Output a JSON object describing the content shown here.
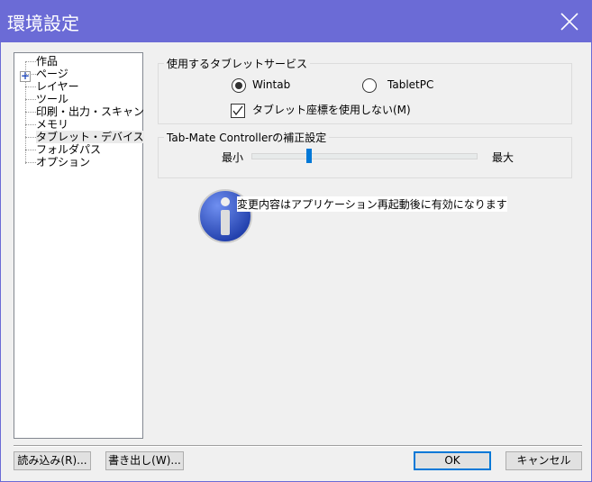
{
  "window": {
    "title": "環境設定"
  },
  "tree": {
    "items": [
      {
        "label": "作品"
      },
      {
        "label": "ページ",
        "expandable": true
      },
      {
        "label": "レイヤー"
      },
      {
        "label": "ツール"
      },
      {
        "label": "印刷・出力・スキャン"
      },
      {
        "label": "メモリ"
      },
      {
        "label": "タブレット・デバイス",
        "selected": true
      },
      {
        "label": "フォルダパス"
      },
      {
        "label": "オプション"
      }
    ]
  },
  "tablet_service": {
    "title": "使用するタブレットサービス",
    "wintab": "Wintab",
    "tabletpc": "TabletPC",
    "selected": "Wintab",
    "no_coords_label": "タブレット座標を使用しない(M)",
    "no_coords_checked": true
  },
  "tabmate": {
    "title": "Tab-Mate Controllerの補正設定",
    "min_label": "最小",
    "max_label": "最大",
    "value_percent": 25
  },
  "message": "変更内容はアプリケーション再起動後に有効になります",
  "buttons": {
    "load": "読み込み(R)...",
    "export": "書き出し(W)...",
    "ok": "OK",
    "cancel": "キャンセル"
  }
}
